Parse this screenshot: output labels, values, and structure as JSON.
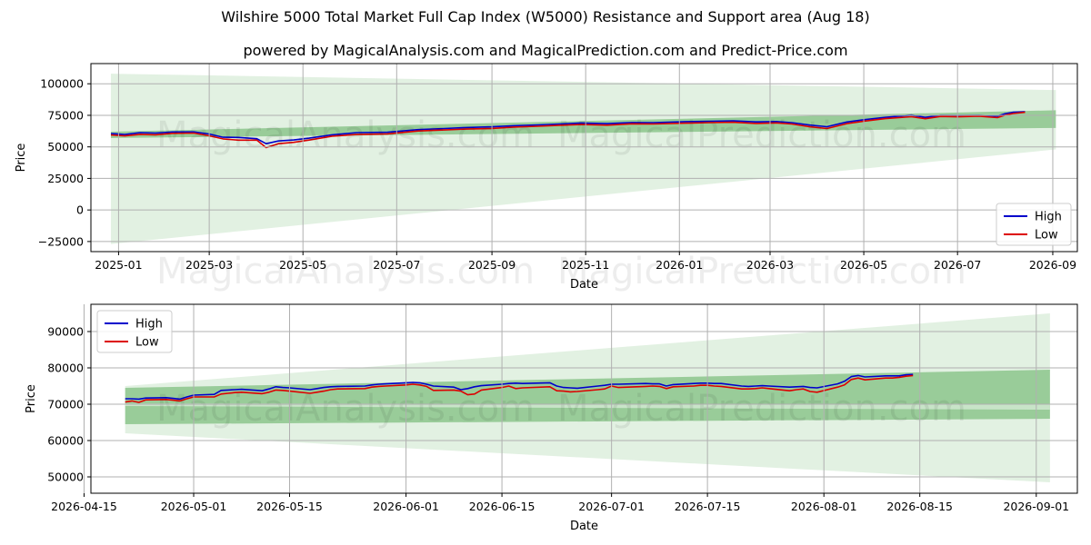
{
  "title": "Wilshire 5000 Total Market Full Cap Index (W5000) Resistance and Support area (Aug 18)",
  "subtitle": "powered by MagicalAnalysis.com and MagicalPrediction.com and Predict-Price.com",
  "watermark": [
    "MagicalAnalysis.com",
    "MagicalPrediction.com"
  ],
  "colors": {
    "high": "#0000cc",
    "low": "#dd0000",
    "band_light": "#d8ecd8",
    "band_dark": "#8cc68c",
    "grid": "#b0b0b0"
  },
  "chart_data": [
    {
      "type": "line",
      "xlabel": "Date",
      "ylabel": "Price",
      "xlim": [
        "2024-12-14",
        "2026-09-17"
      ],
      "ylim": [
        -33000,
        116000
      ],
      "yticks": [
        -25000,
        0,
        25000,
        50000,
        75000,
        100000
      ],
      "ytick_labels": [
        "−25000",
        "0",
        "25000",
        "50000",
        "75000",
        "100000"
      ],
      "xticks": [
        "2025-01-01",
        "2025-03-01",
        "2025-05-01",
        "2025-07-01",
        "2025-09-01",
        "2025-11-01",
        "2026-01-01",
        "2026-03-01",
        "2026-05-01",
        "2026-07-01",
        "2026-09-01"
      ],
      "xtick_labels": [
        "2025-01",
        "2025-03",
        "2025-05",
        "2025-07",
        "2025-09",
        "2025-11",
        "2026-01",
        "2026-03",
        "2026-05",
        "2026-07",
        "2026-09"
      ],
      "legend": [
        "High",
        "Low"
      ],
      "legend_position": "lower right",
      "grid": true,
      "bands": [
        {
          "style": "light",
          "x": [
            "2024-12-27",
            "2026-09-03"
          ],
          "upper": [
            108000,
            95000
          ],
          "lower": [
            -27000,
            48000
          ]
        },
        {
          "style": "dark",
          "x": [
            "2024-12-27",
            "2026-09-03"
          ],
          "upper": [
            62000,
            79000
          ],
          "lower": [
            57000,
            65000
          ]
        }
      ],
      "series": [
        {
          "name": "High",
          "x": [
            "2024-12-27",
            "2025-01-05",
            "2025-01-15",
            "2025-01-25",
            "2025-02-05",
            "2025-02-19",
            "2025-03-01",
            "2025-03-10",
            "2025-03-20",
            "2025-04-01",
            "2025-04-07",
            "2025-04-15",
            "2025-04-25",
            "2025-05-05",
            "2025-05-20",
            "2025-06-05",
            "2025-06-25",
            "2025-07-15",
            "2025-08-01",
            "2025-08-15",
            "2025-09-01",
            "2025-09-15",
            "2025-10-01",
            "2025-10-15",
            "2025-10-29",
            "2025-11-15",
            "2025-12-01",
            "2025-12-15",
            "2026-01-05",
            "2026-01-20",
            "2026-02-05",
            "2026-02-20",
            "2026-03-05",
            "2026-03-15",
            "2026-03-27",
            "2026-04-07",
            "2026-04-20",
            "2026-05-01",
            "2026-05-15",
            "2026-06-01",
            "2026-06-10",
            "2026-06-20",
            "2026-07-01",
            "2026-07-15",
            "2026-07-27",
            "2026-08-01",
            "2026-08-06",
            "2026-08-14"
          ],
          "values": [
            60600,
            59800,
            61300,
            60900,
            61800,
            61900,
            60200,
            57600,
            57500,
            56500,
            52500,
            54700,
            55500,
            56900,
            59600,
            61300,
            61600,
            63700,
            64500,
            65300,
            65900,
            66800,
            67400,
            68100,
            68900,
            68400,
            69300,
            69200,
            70000,
            70300,
            70600,
            69800,
            70100,
            69200,
            67300,
            66000,
            69700,
            71500,
            73400,
            75200,
            73400,
            75000,
            74800,
            75000,
            74400,
            76300,
            77400,
            77800
          ]
        },
        {
          "name": "Low",
          "x": [
            "2024-12-27",
            "2025-01-05",
            "2025-01-15",
            "2025-01-25",
            "2025-02-05",
            "2025-02-19",
            "2025-03-01",
            "2025-03-10",
            "2025-03-20",
            "2025-04-01",
            "2025-04-07",
            "2025-04-15",
            "2025-04-25",
            "2025-05-05",
            "2025-05-20",
            "2025-06-05",
            "2025-06-25",
            "2025-07-15",
            "2025-08-01",
            "2025-08-15",
            "2025-09-01",
            "2025-09-15",
            "2025-10-01",
            "2025-10-15",
            "2025-10-29",
            "2025-11-15",
            "2025-12-01",
            "2025-12-15",
            "2026-01-05",
            "2026-01-20",
            "2026-02-05",
            "2026-02-20",
            "2026-03-05",
            "2026-03-15",
            "2026-03-27",
            "2026-04-07",
            "2026-04-20",
            "2026-05-01",
            "2026-05-15",
            "2026-06-01",
            "2026-06-10",
            "2026-06-20",
            "2026-07-01",
            "2026-07-15",
            "2026-07-27",
            "2026-08-01",
            "2026-08-06",
            "2026-08-14"
          ],
          "values": [
            59400,
            58700,
            59900,
            59600,
            60700,
            60900,
            58800,
            56300,
            55300,
            55300,
            49400,
            52500,
            53600,
            55400,
            58500,
            59800,
            60300,
            62600,
            63400,
            64100,
            64600,
            65700,
            66300,
            67100,
            67700,
            67200,
            68300,
            68100,
            68800,
            69200,
            69500,
            68600,
            69000,
            68100,
            65900,
            64500,
            68400,
            70400,
            72400,
            73900,
            72300,
            74100,
            73800,
            74300,
            73200,
            75200,
            76400,
            77400
          ]
        }
      ]
    },
    {
      "type": "line",
      "xlabel": "Date",
      "ylabel": "Price",
      "xlim": [
        "2026-04-16",
        "2026-09-07"
      ],
      "ylim": [
        45500,
        97500
      ],
      "yticks": [
        50000,
        60000,
        70000,
        80000,
        90000
      ],
      "ytick_labels": [
        "50000",
        "60000",
        "70000",
        "80000",
        "90000"
      ],
      "xticks": [
        "2026-04-15",
        "2026-05-01",
        "2026-05-15",
        "2026-06-01",
        "2026-06-15",
        "2026-07-01",
        "2026-07-15",
        "2026-08-01",
        "2026-08-15",
        "2026-09-01"
      ],
      "xtick_labels": [
        "2026-04-15",
        "2026-05-01",
        "2026-05-15",
        "2026-06-01",
        "2026-06-15",
        "2026-07-01",
        "2026-07-15",
        "2026-08-01",
        "2026-08-15",
        "2026-09-01"
      ],
      "legend": [
        "High",
        "Low"
      ],
      "legend_position": "upper left",
      "grid": true,
      "bands": [
        {
          "style": "light",
          "x": [
            "2026-04-21",
            "2026-09-03"
          ],
          "upper": [
            75000,
            95000
          ],
          "lower": [
            62000,
            48500
          ]
        },
        {
          "style": "dark",
          "x": [
            "2026-04-21",
            "2026-09-03"
          ],
          "upper": [
            74500,
            79500
          ],
          "lower": [
            64500,
            66000
          ]
        },
        {
          "style": "light",
          "x": [
            "2026-04-21",
            "2026-09-03"
          ],
          "upper": [
            70200,
            70000
          ],
          "lower": [
            69500,
            68500
          ]
        }
      ],
      "series": [
        {
          "name": "High",
          "x": [
            "2026-04-21",
            "2026-04-22",
            "2026-04-23",
            "2026-04-24",
            "2026-04-27",
            "2026-04-28",
            "2026-04-29",
            "2026-04-30",
            "2026-05-01",
            "2026-05-04",
            "2026-05-05",
            "2026-05-06",
            "2026-05-07",
            "2026-05-08",
            "2026-05-11",
            "2026-05-12",
            "2026-05-13",
            "2026-05-14",
            "2026-05-15",
            "2026-05-18",
            "2026-05-19",
            "2026-05-20",
            "2026-05-21",
            "2026-05-22",
            "2026-05-26",
            "2026-05-27",
            "2026-05-28",
            "2026-05-29",
            "2026-06-01",
            "2026-06-02",
            "2026-06-03",
            "2026-06-04",
            "2026-06-05",
            "2026-06-08",
            "2026-06-09",
            "2026-06-10",
            "2026-06-11",
            "2026-06-12",
            "2026-06-15",
            "2026-06-16",
            "2026-06-17",
            "2026-06-18",
            "2026-06-22",
            "2026-06-23",
            "2026-06-24",
            "2026-06-25",
            "2026-06-26",
            "2026-06-29",
            "2026-06-30",
            "2026-07-01",
            "2026-07-02",
            "2026-07-06",
            "2026-07-07",
            "2026-07-08",
            "2026-07-09",
            "2026-07-10",
            "2026-07-13",
            "2026-07-14",
            "2026-07-15",
            "2026-07-16",
            "2026-07-17",
            "2026-07-20",
            "2026-07-21",
            "2026-07-22",
            "2026-07-23",
            "2026-07-24",
            "2026-07-27",
            "2026-07-28",
            "2026-07-29",
            "2026-07-30",
            "2026-07-31",
            "2026-08-03",
            "2026-08-04",
            "2026-08-05",
            "2026-08-06",
            "2026-08-07",
            "2026-08-10",
            "2026-08-11",
            "2026-08-12",
            "2026-08-13",
            "2026-08-14"
          ],
          "values": [
            71500,
            71500,
            71400,
            71700,
            71800,
            71600,
            71400,
            72000,
            72500,
            72700,
            73800,
            73900,
            74000,
            74100,
            73700,
            74200,
            74800,
            74600,
            74500,
            74000,
            74300,
            74600,
            74800,
            74900,
            75000,
            75300,
            75500,
            75600,
            75900,
            76000,
            75900,
            75500,
            75000,
            74700,
            74000,
            74300,
            74800,
            75100,
            75500,
            75700,
            75800,
            75700,
            75900,
            75000,
            74600,
            74500,
            74400,
            75000,
            75200,
            75500,
            75500,
            75700,
            75600,
            75600,
            75000,
            75400,
            75700,
            75800,
            75800,
            75700,
            75700,
            75000,
            74900,
            75000,
            75100,
            75000,
            74700,
            74800,
            74900,
            74600,
            74500,
            75600,
            76300,
            77600,
            77900,
            77500,
            77800,
            77800,
            77800,
            78100,
            78200
          ]
        },
        {
          "name": "Low",
          "x": [
            "2026-04-21",
            "2026-04-22",
            "2026-04-23",
            "2026-04-24",
            "2026-04-27",
            "2026-04-28",
            "2026-04-29",
            "2026-04-30",
            "2026-05-01",
            "2026-05-04",
            "2026-05-05",
            "2026-05-06",
            "2026-05-07",
            "2026-05-08",
            "2026-05-11",
            "2026-05-12",
            "2026-05-13",
            "2026-05-14",
            "2026-05-15",
            "2026-05-18",
            "2026-05-19",
            "2026-05-20",
            "2026-05-21",
            "2026-05-22",
            "2026-05-26",
            "2026-05-27",
            "2026-05-28",
            "2026-05-29",
            "2026-06-01",
            "2026-06-02",
            "2026-06-03",
            "2026-06-04",
            "2026-06-05",
            "2026-06-08",
            "2026-06-09",
            "2026-06-10",
            "2026-06-11",
            "2026-06-12",
            "2026-06-15",
            "2026-06-16",
            "2026-06-17",
            "2026-06-18",
            "2026-06-22",
            "2026-06-23",
            "2026-06-24",
            "2026-06-25",
            "2026-06-26",
            "2026-06-29",
            "2026-06-30",
            "2026-07-01",
            "2026-07-02",
            "2026-07-06",
            "2026-07-07",
            "2026-07-08",
            "2026-07-09",
            "2026-07-10",
            "2026-07-13",
            "2026-07-14",
            "2026-07-15",
            "2026-07-16",
            "2026-07-17",
            "2026-07-20",
            "2026-07-21",
            "2026-07-22",
            "2026-07-23",
            "2026-07-24",
            "2026-07-27",
            "2026-07-28",
            "2026-07-29",
            "2026-07-30",
            "2026-07-31",
            "2026-08-03",
            "2026-08-04",
            "2026-08-05",
            "2026-08-06",
            "2026-08-07",
            "2026-08-10",
            "2026-08-11",
            "2026-08-12",
            "2026-08-13",
            "2026-08-14"
          ],
          "values": [
            70600,
            70900,
            70500,
            71200,
            71300,
            71100,
            70900,
            71500,
            72000,
            72000,
            72800,
            73000,
            73200,
            73300,
            72900,
            73300,
            73900,
            73800,
            73600,
            73000,
            73300,
            73600,
            74000,
            74200,
            74300,
            74700,
            74900,
            75000,
            75300,
            75500,
            75300,
            74900,
            73800,
            73900,
            73600,
            72600,
            72800,
            73900,
            74600,
            75000,
            74300,
            74500,
            74800,
            73700,
            73600,
            73400,
            73500,
            74000,
            74200,
            75000,
            74600,
            74900,
            75000,
            74900,
            74300,
            74800,
            75000,
            75200,
            75200,
            75000,
            74900,
            74200,
            74200,
            74300,
            74500,
            74300,
            73700,
            74000,
            74200,
            73500,
            73300,
            74700,
            75300,
            76800,
            77200,
            76700,
            77200,
            77200,
            77400,
            77700,
            77900
          ]
        }
      ]
    }
  ]
}
